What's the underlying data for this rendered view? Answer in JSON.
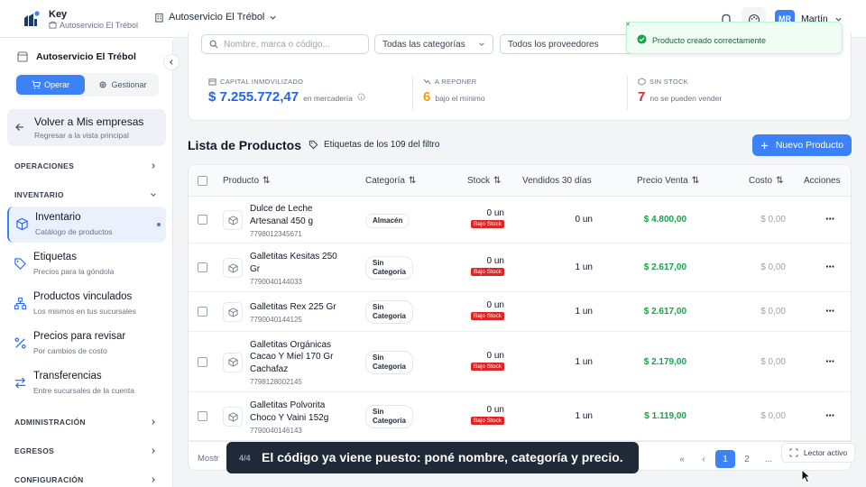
{
  "topbar": {
    "brand_title": "Key",
    "brand_sub": "Autoservicio El Trébol",
    "store_selector": "Autoservicio El Trébol",
    "user_initials": "MR",
    "user_name": "Martín"
  },
  "sidebar": {
    "store_name": "Autoservicio El Trébol",
    "mode_operar": "Operar",
    "mode_gestionar": "Gestionar",
    "back_title": "Volver a Mis empresas",
    "back_sub": "Regresar a la vista principal",
    "sections": {
      "operaciones": "OPERACIONES",
      "inventario": "INVENTARIO",
      "administracion": "ADMINISTRACIÓN",
      "egresos": "EGRESOS",
      "configuracion": "CONFIGURACIÓN"
    },
    "items": [
      {
        "label": "Inventario",
        "sub": "Catálogo de productos"
      },
      {
        "label": "Etiquetas",
        "sub": "Precios para la góndola"
      },
      {
        "label": "Productos vinculados",
        "sub": "Los mismos en tus sucursales"
      },
      {
        "label": "Precios para revisar",
        "sub": "Por cambios de costo"
      },
      {
        "label": "Transferencias",
        "sub": "Entre sucursales de la cuenta"
      }
    ]
  },
  "filters": {
    "search_placeholder": "Nombre, marca o código...",
    "category": "Todas las categorías",
    "supplier": "Todos los proveedores"
  },
  "stats": [
    {
      "label": "CAPITAL INMOVILIZADO",
      "value": "$ 7.255.772,47",
      "desc": "en mercadería",
      "color": "#2563eb"
    },
    {
      "label": "A REPONER",
      "value": "6",
      "desc": "bajo el mínimo",
      "color": "#f59e0b"
    },
    {
      "label": "SIN STOCK",
      "value": "7",
      "desc": "no se pueden vender",
      "color": "#dc2626"
    }
  ],
  "list": {
    "title": "Lista de Productos",
    "labels_button": "Etiquetas de los 109 del filtro",
    "new_button": "Nuevo Producto"
  },
  "table": {
    "headers": {
      "product": "Producto",
      "category": "Categoría",
      "stock": "Stock",
      "sold": "Vendidos 30 días",
      "price": "Precio Venta",
      "cost": "Costo",
      "actions": "Acciones"
    },
    "rows": [
      {
        "name": "Dulce de Leche Artesanal 450 g",
        "code": "7798012345671",
        "category": "Almacén",
        "stock": "0 un",
        "badge": "Bajo Stock",
        "sold": "0 un",
        "price": "$ 4.800,00",
        "cost": "$ 0,00"
      },
      {
        "name": "Galletitas Kesitas 250 Gr",
        "code": "7790040144033",
        "category": "Sin\nCategoría",
        "stock": "0 un",
        "badge": "Bajo Stock",
        "sold": "1 un",
        "price": "$ 2.617,00",
        "cost": "$ 0,00"
      },
      {
        "name": "Galletitas Rex 225 Gr",
        "code": "7790040144125",
        "category": "Sin\nCategoría",
        "stock": "0 un",
        "badge": "Bajo Stock",
        "sold": "1 un",
        "price": "$ 2.617,00",
        "cost": "$ 0,00"
      },
      {
        "name": "Galletitas Orgánicas Cacao Y Miel 170 Gr Cachafaz",
        "code": "7798128002145",
        "category": "Sin\nCategoría",
        "stock": "0 un",
        "badge": "Bajo Stock",
        "sold": "1 un",
        "price": "$ 2.179,00",
        "cost": "$ 0,00"
      },
      {
        "name": "Galletitas Polvorita Choco Y Vaini 152g",
        "code": "7790040146143",
        "category": "Sin\nCategoría",
        "stock": "0 un",
        "badge": "Bajo Stock",
        "sold": "1 un",
        "price": "$ 1.119,00",
        "cost": "$ 0,00"
      }
    ],
    "footer_text": "Mostr",
    "pages": [
      "1",
      "2",
      "..."
    ]
  },
  "lector": "Lector activo",
  "toast": "Producto creado correctamente",
  "caption": {
    "step": "4/4",
    "text": "El código ya viene puesto: poné nombre, categoría y precio."
  }
}
